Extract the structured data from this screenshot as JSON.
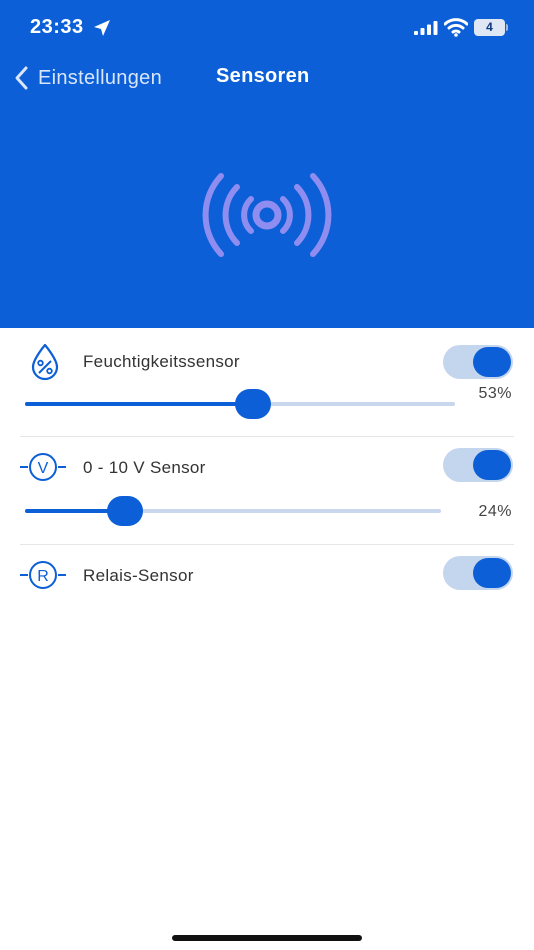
{
  "status_bar": {
    "time": "23:33",
    "battery": "4",
    "icons": [
      "location-arrow-icon",
      "cellular-signal-icon",
      "wifi-icon",
      "battery-icon"
    ]
  },
  "nav": {
    "back_label": "Einstellungen",
    "title": "Sensoren",
    "back_icon": "chevron-left-icon"
  },
  "hero": {
    "icon": "sensor-broadcast-icon"
  },
  "sensors": [
    {
      "label": "Feuchtigkeitssensor",
      "icon": "humidity-drop-icon",
      "enabled": true,
      "value": "53%",
      "level": 0.53
    },
    {
      "label": "0 - 10 V Sensor",
      "icon": "voltage-v-icon",
      "enabled": true,
      "value": "24%",
      "level": 0.24
    },
    {
      "label": "Relais-Sensor",
      "icon": "relay-r-icon",
      "enabled": true
    }
  ],
  "colors": {
    "primary": "#0c5fd6",
    "toggle_track": "#c4d5ee",
    "slider_track": "#c8d6ee",
    "hero_icon": "#8f8ef0"
  }
}
